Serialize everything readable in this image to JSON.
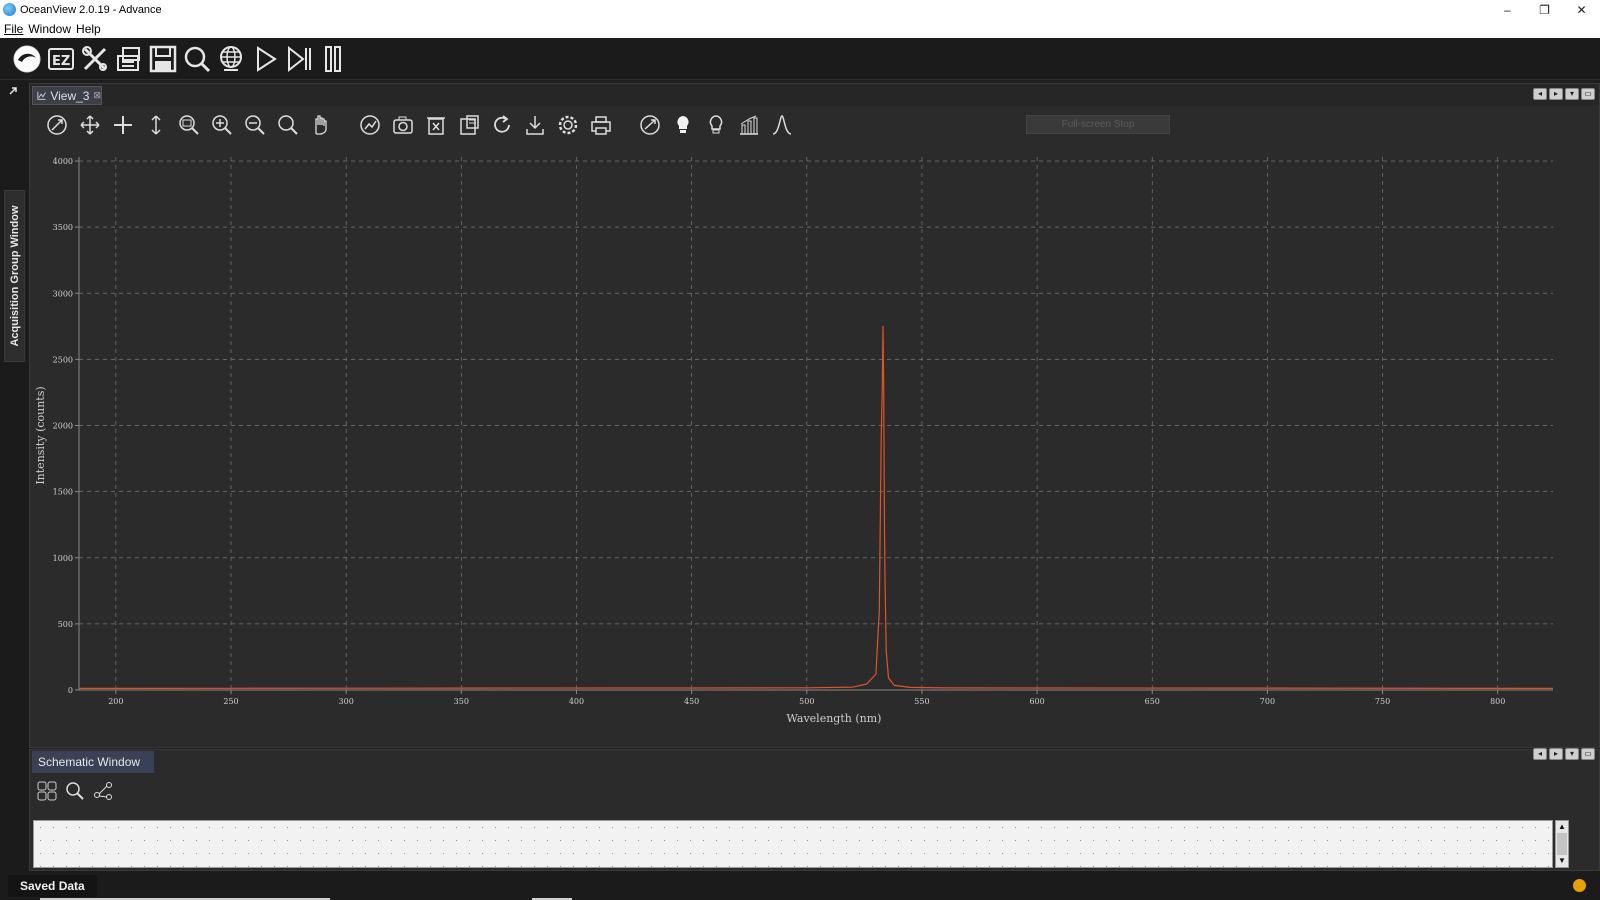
{
  "window": {
    "title": "OceanView 2.0.19 - Advance",
    "minimize_glyph": "–",
    "restore_glyph": "❐",
    "close_glyph": "✕"
  },
  "menu": {
    "items": [
      "File",
      "Window",
      "Help"
    ]
  },
  "main_toolbar": {
    "icons": [
      "oceanview-logo-icon",
      "ez-icon",
      "tools-icon",
      "export-icon",
      "save-icon",
      "search-icon",
      "globe-icon",
      "play-icon",
      "step-icon",
      "pause-icon"
    ]
  },
  "sidebar": {
    "vertical_tab": "Acquisition Group Window"
  },
  "view": {
    "tab_label": "View_3",
    "close_glyph": "⊠",
    "fullscreen_button": "Full-screen Stop",
    "toolbar_icons": [
      "auto-scale-icon",
      "pan-icon",
      "crosshair-icon",
      "vertical-scale-icon",
      "zoom-area-icon",
      "zoom-in-icon",
      "zoom-out-icon",
      "zoom-reset-icon",
      "hand-icon",
      "overlay-icon",
      "camera-icon",
      "delete-icon",
      "clipboard-icon",
      "refresh-icon",
      "download-icon",
      "settings-icon",
      "print-icon",
      "reference-icon",
      "lamp-on-icon",
      "lamp-off-icon",
      "bar-chart-icon",
      "peak-icon"
    ]
  },
  "chart_data": {
    "type": "line",
    "xlabel": "Wavelength (nm)",
    "ylabel": "Intensity (counts)",
    "xlim": [
      184,
      824
    ],
    "ylim": [
      0,
      4000
    ],
    "x_ticks": [
      200,
      250,
      300,
      350,
      400,
      450,
      500,
      550,
      600,
      650,
      700,
      750,
      800
    ],
    "y_ticks": [
      0,
      500,
      1000,
      1500,
      2000,
      2500,
      3000,
      3500,
      4000
    ],
    "grid": true,
    "colors": {
      "line": "#e0542a",
      "grid": "#777777",
      "axis": "#888888",
      "tick_text": "#cfcfcf"
    },
    "series": [
      {
        "x": [
          184,
          250,
          350,
          450,
          500,
          520,
          526,
          530,
          531.5,
          532.3,
          532.8,
          533.1,
          533.4,
          533.7,
          534.0,
          534.5,
          535.5,
          538,
          545,
          560,
          600,
          700,
          824
        ],
        "y": [
          12,
          13,
          14,
          15,
          17,
          22,
          45,
          120,
          600,
          1900,
          2300,
          2750,
          2300,
          1300,
          800,
          300,
          90,
          35,
          20,
          16,
          15,
          14,
          12
        ]
      }
    ]
  },
  "schematic": {
    "tab_label": "Schematic Window",
    "tool_icons": [
      "grid-layout-icon",
      "search-icon",
      "connections-icon"
    ],
    "scroll_up": "▲",
    "scroll_down": "▼"
  },
  "status": {
    "saved_data_label": "Saved Data",
    "indicator_color": "#e7a000"
  }
}
